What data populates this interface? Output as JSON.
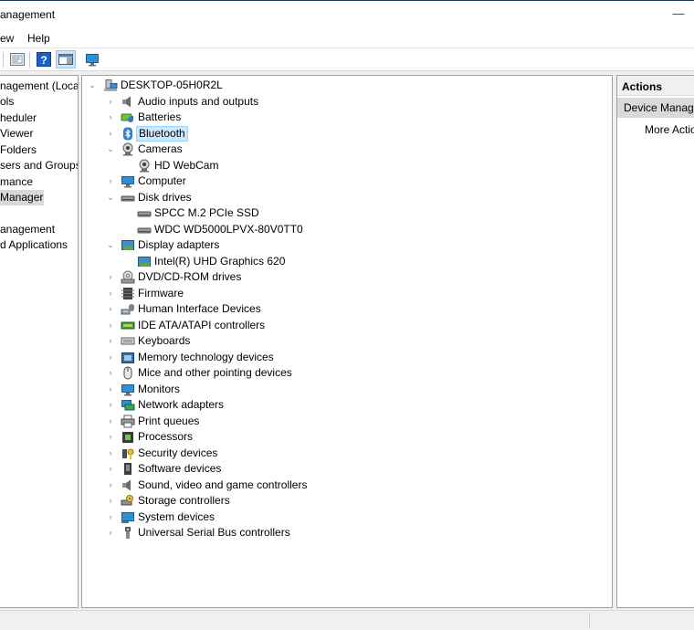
{
  "window": {
    "title": "anagement",
    "minimize_glyph": "—"
  },
  "menubar": {
    "items": [
      "ew",
      "Help"
    ]
  },
  "toolbar": {
    "icons": [
      "properties-icon",
      "help-icon",
      "show-hide-action-pane-icon",
      "monitor-icon"
    ]
  },
  "nav": {
    "items": [
      {
        "label": "nagement (Local)",
        "selected": false
      },
      {
        "label": "ols",
        "selected": false
      },
      {
        "label": "heduler",
        "selected": false
      },
      {
        "label": "Viewer",
        "selected": false
      },
      {
        "label": "Folders",
        "selected": false
      },
      {
        "label": "sers and Groups",
        "selected": false
      },
      {
        "label": "mance",
        "selected": false
      },
      {
        "label": "Manager",
        "selected": true
      },
      {
        "label": "",
        "selected": false
      },
      {
        "label": "anagement",
        "selected": false
      },
      {
        "label": "d Applications",
        "selected": false
      }
    ]
  },
  "tree": {
    "root": {
      "label": "DESKTOP-05H0R2L",
      "expanded": true,
      "icon": "computer-tree-icon"
    },
    "rows": [
      {
        "label": "Audio inputs and outputs",
        "level": 1,
        "expander": "collapsed",
        "icon": "speaker-icon",
        "selected": false
      },
      {
        "label": "Batteries",
        "level": 1,
        "expander": "collapsed",
        "icon": "battery-icon",
        "selected": false
      },
      {
        "label": "Bluetooth",
        "level": 1,
        "expander": "collapsed",
        "icon": "bluetooth-icon",
        "selected": true
      },
      {
        "label": "Cameras",
        "level": 1,
        "expander": "expanded",
        "icon": "webcam-icon",
        "selected": false
      },
      {
        "label": "HD WebCam",
        "level": 2,
        "expander": "none",
        "icon": "webcam-icon",
        "selected": false
      },
      {
        "label": "Computer",
        "level": 1,
        "expander": "collapsed",
        "icon": "monitor-icon",
        "selected": false
      },
      {
        "label": "Disk drives",
        "level": 1,
        "expander": "expanded",
        "icon": "disk-drive-icon",
        "selected": false
      },
      {
        "label": "SPCC M.2 PCIe SSD",
        "level": 2,
        "expander": "none",
        "icon": "disk-drive-icon",
        "selected": false
      },
      {
        "label": "WDC WD5000LPVX-80V0TT0",
        "level": 2,
        "expander": "none",
        "icon": "disk-drive-icon",
        "selected": false
      },
      {
        "label": "Display adapters",
        "level": 1,
        "expander": "expanded",
        "icon": "display-adapter-icon",
        "selected": false
      },
      {
        "label": "Intel(R) UHD Graphics 620",
        "level": 2,
        "expander": "none",
        "icon": "display-adapter-icon",
        "selected": false
      },
      {
        "label": "DVD/CD-ROM drives",
        "level": 1,
        "expander": "collapsed",
        "icon": "dvd-drive-icon",
        "selected": false
      },
      {
        "label": "Firmware",
        "level": 1,
        "expander": "collapsed",
        "icon": "firmware-icon",
        "selected": false
      },
      {
        "label": "Human Interface Devices",
        "level": 1,
        "expander": "collapsed",
        "icon": "hid-icon",
        "selected": false
      },
      {
        "label": "IDE ATA/ATAPI controllers",
        "level": 1,
        "expander": "collapsed",
        "icon": "ide-controller-icon",
        "selected": false
      },
      {
        "label": "Keyboards",
        "level": 1,
        "expander": "collapsed",
        "icon": "keyboard-icon",
        "selected": false
      },
      {
        "label": "Memory technology devices",
        "level": 1,
        "expander": "collapsed",
        "icon": "memory-device-icon",
        "selected": false
      },
      {
        "label": "Mice and other pointing devices",
        "level": 1,
        "expander": "collapsed",
        "icon": "mouse-icon",
        "selected": false
      },
      {
        "label": "Monitors",
        "level": 1,
        "expander": "collapsed",
        "icon": "monitor-icon",
        "selected": false
      },
      {
        "label": "Network adapters",
        "level": 1,
        "expander": "collapsed",
        "icon": "network-adapter-icon",
        "selected": false
      },
      {
        "label": "Print queues",
        "level": 1,
        "expander": "collapsed",
        "icon": "printer-icon",
        "selected": false
      },
      {
        "label": "Processors",
        "level": 1,
        "expander": "collapsed",
        "icon": "processor-icon",
        "selected": false
      },
      {
        "label": "Security devices",
        "level": 1,
        "expander": "collapsed",
        "icon": "security-device-icon",
        "selected": false
      },
      {
        "label": "Software devices",
        "level": 1,
        "expander": "collapsed",
        "icon": "software-device-icon",
        "selected": false
      },
      {
        "label": "Sound, video and game controllers",
        "level": 1,
        "expander": "collapsed",
        "icon": "speaker-icon",
        "selected": false
      },
      {
        "label": "Storage controllers",
        "level": 1,
        "expander": "collapsed",
        "icon": "storage-controller-icon",
        "selected": false
      },
      {
        "label": "System devices",
        "level": 1,
        "expander": "collapsed",
        "icon": "system-device-icon",
        "selected": false
      },
      {
        "label": "Universal Serial Bus controllers",
        "level": 1,
        "expander": "collapsed",
        "icon": "usb-icon",
        "selected": false
      }
    ]
  },
  "actions": {
    "title": "Actions",
    "section": "Device Manager",
    "more": "More Actions"
  },
  "colors": {
    "selection_bg": "#cce8ff",
    "selection_border": "#99d1ff",
    "nav_selected_bg": "#d9d9d9",
    "title_border": "#1f3b57"
  }
}
